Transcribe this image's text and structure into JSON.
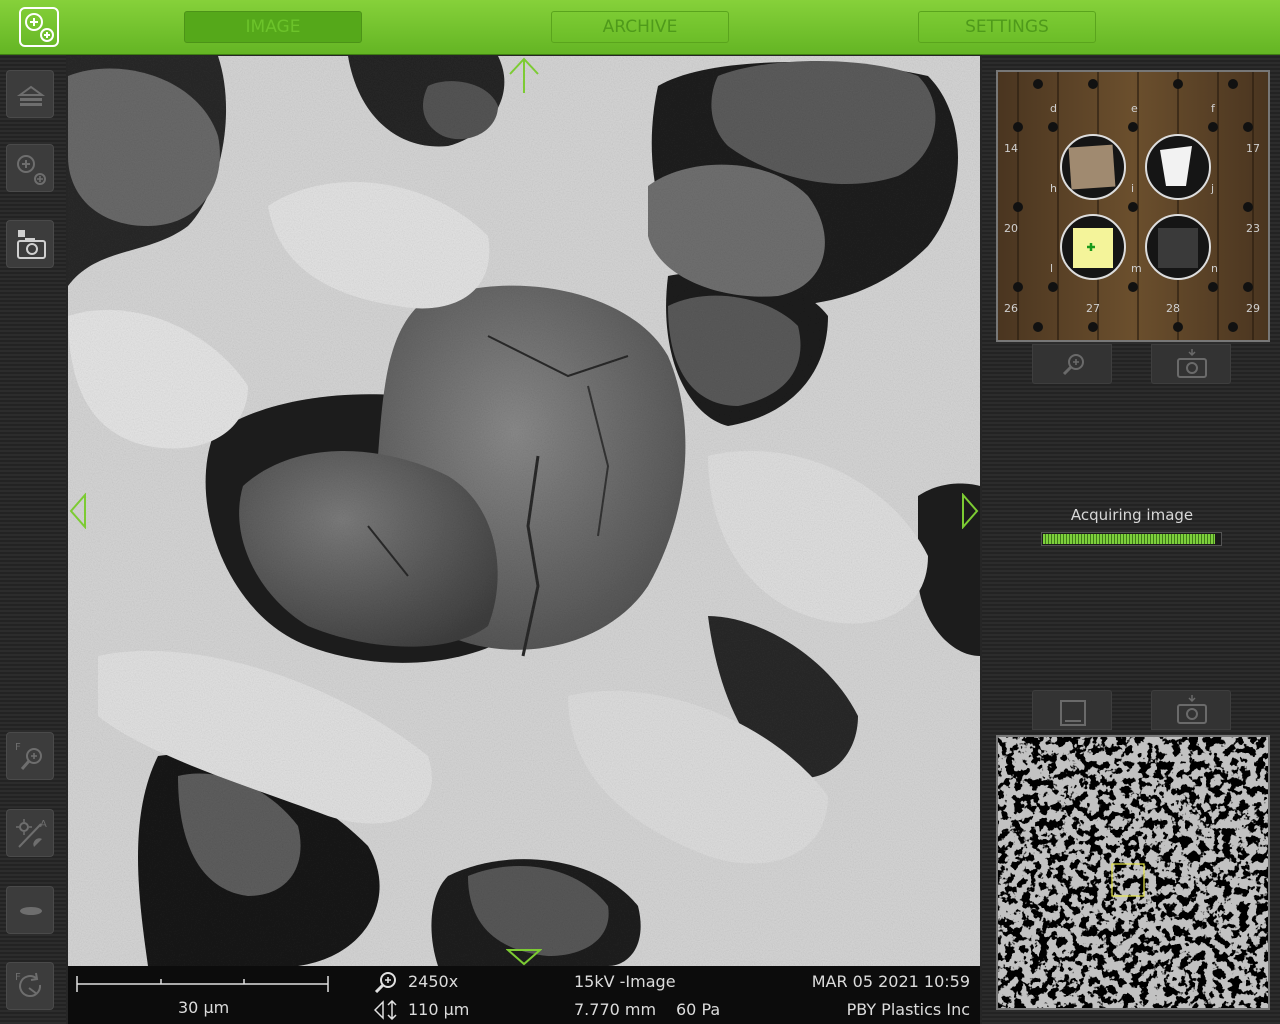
{
  "tabs": [
    {
      "label": "IMAGE",
      "active": true
    },
    {
      "label": "ARCHIVE",
      "active": false
    },
    {
      "label": "SETTINGS",
      "active": false
    }
  ],
  "left_toolbar": [
    {
      "name": "eject-icon"
    },
    {
      "name": "zoom-stage-icon"
    },
    {
      "name": "camera-icon"
    },
    {
      "name": "focus-icon"
    },
    {
      "name": "auto-brightness-icon"
    },
    {
      "name": "lens-icon"
    },
    {
      "name": "rotate-icon"
    }
  ],
  "status_bar": {
    "scale_label": "30 μm",
    "magnification": "2450x",
    "field_width": "110 μm",
    "detector_mode": "15kV -Image",
    "working_distance": "7.770 mm",
    "pressure": "60 Pa",
    "datetime": "MAR 05 2021 10:59",
    "operator": "PBY Plastics Inc"
  },
  "nav_camera": {
    "labels": [
      "d",
      "e",
      "f",
      "14",
      "h",
      "i",
      "j",
      "17",
      "20",
      "l",
      "m",
      "n",
      "23",
      "26",
      "27",
      "28",
      "29"
    ]
  },
  "acquisition": {
    "label": "Acquiring image",
    "progress": 0.97
  },
  "colors": {
    "accent": "#7ccb33",
    "topbar": "#6cbd28",
    "sample_selected": "#f4f49a"
  }
}
